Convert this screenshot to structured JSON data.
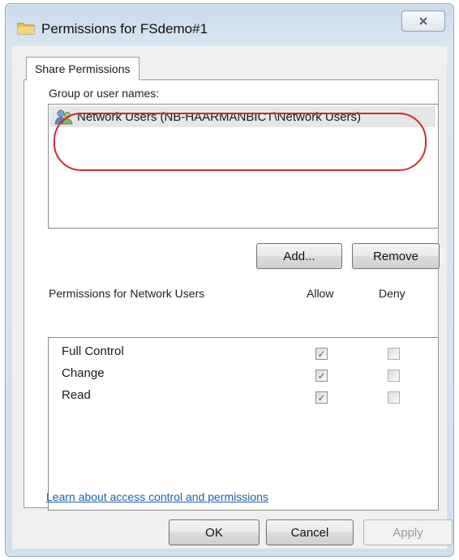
{
  "window": {
    "title": "Permissions for FSdemo#1"
  },
  "tabs": [
    {
      "label": "Share Permissions"
    }
  ],
  "groups": {
    "label": "Group or user names:",
    "items": [
      {
        "name": "Network Users (NB-HAARMANBICT\\Network Users)"
      }
    ]
  },
  "buttons": {
    "add": "Add...",
    "remove": "Remove",
    "ok": "OK",
    "cancel": "Cancel",
    "apply": "Apply"
  },
  "permissions": {
    "header": "Permissions for Network Users",
    "allow_header": "Allow",
    "deny_header": "Deny",
    "rows": [
      {
        "name": "Full Control",
        "allow": true,
        "deny": false
      },
      {
        "name": "Change",
        "allow": true,
        "deny": false
      },
      {
        "name": "Read",
        "allow": true,
        "deny": false
      }
    ]
  },
  "link": {
    "text": "Learn about access control and permissions"
  },
  "icons": {
    "folder": "folder-icon",
    "close": "close-icon",
    "users": "users-group-icon",
    "check": "checkmark-icon"
  },
  "colors": {
    "highlight": "#d42a2a",
    "link": "#1c5fb0",
    "selection": "#e6e6e6"
  }
}
